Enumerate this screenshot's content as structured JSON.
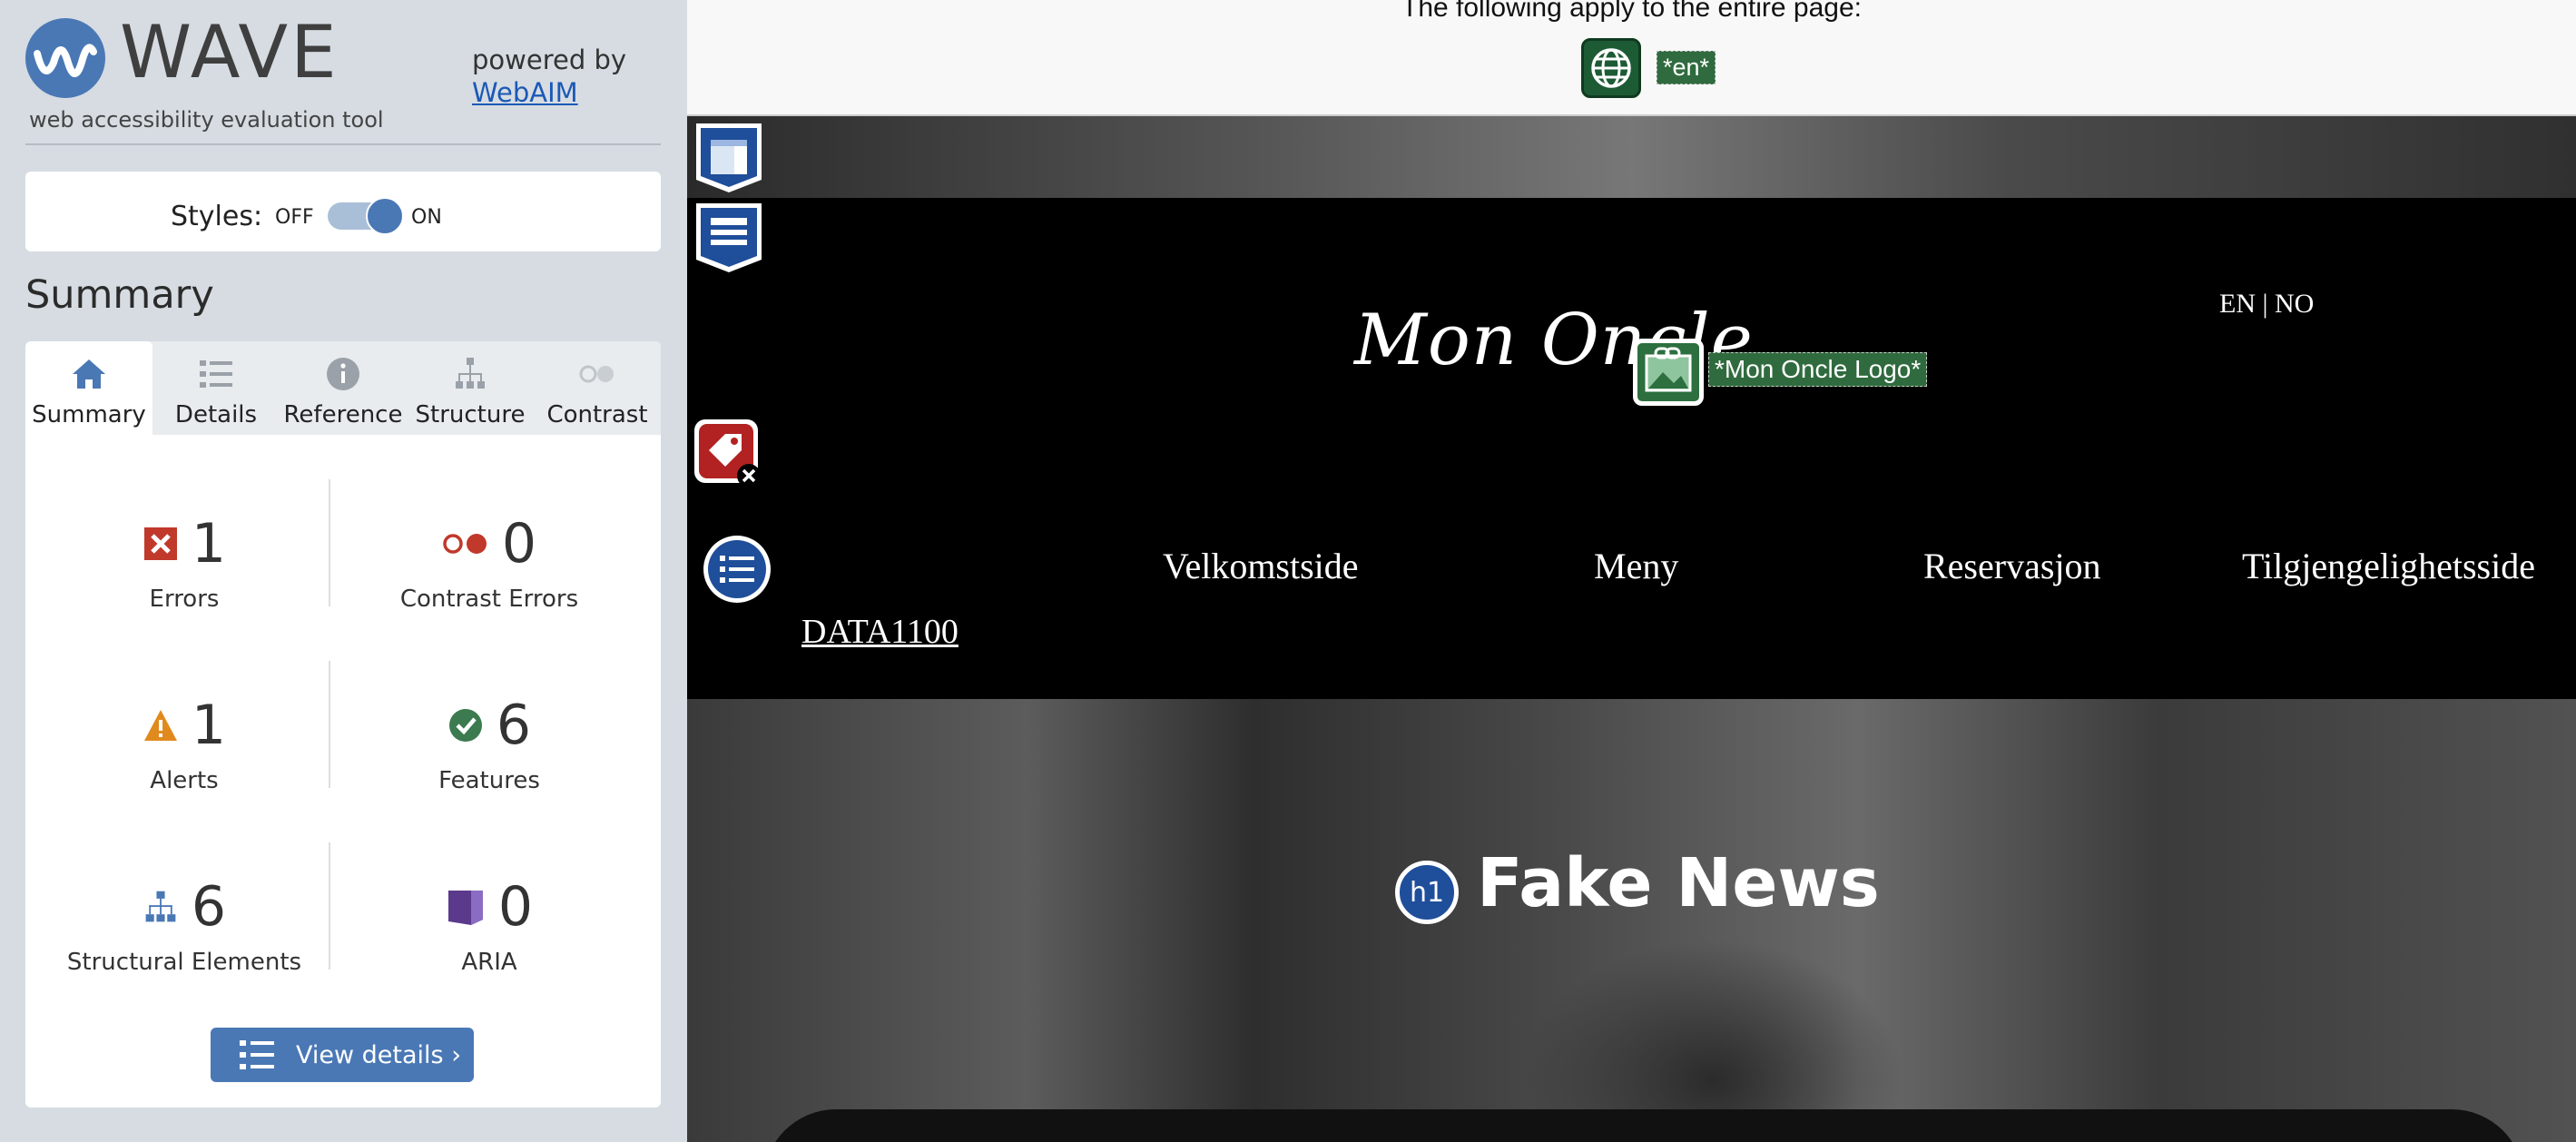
{
  "app": {
    "name": "WAVE",
    "tagline": "web accessibility evaluation tool",
    "powered_by": "powered by",
    "powered_by_link": "WebAIM"
  },
  "styles_toggle": {
    "label": "Styles:",
    "off_label": "OFF",
    "on_label": "ON",
    "state": "on"
  },
  "summary_heading": "Summary",
  "tabs": [
    {
      "label": "Summary",
      "icon": "home-icon",
      "active": true
    },
    {
      "label": "Details",
      "icon": "list-icon",
      "active": false
    },
    {
      "label": "Reference",
      "icon": "info-icon",
      "active": false
    },
    {
      "label": "Structure",
      "icon": "hierarchy-icon",
      "active": false
    },
    {
      "label": "Contrast",
      "icon": "contrast-icon",
      "active": false
    }
  ],
  "stats": {
    "errors": {
      "count": "1",
      "label": "Errors",
      "icon": "error-x-icon"
    },
    "contrast_errors": {
      "count": "0",
      "label": "Contrast Errors",
      "icon": "contrast-error-icon"
    },
    "alerts": {
      "count": "1",
      "label": "Alerts",
      "icon": "alert-triangle-icon"
    },
    "features": {
      "count": "6",
      "label": "Features",
      "icon": "checkmark-icon"
    },
    "structural": {
      "count": "6",
      "label": "Structural Elements",
      "icon": "structure-icon"
    },
    "aria": {
      "count": "0",
      "label": "ARIA",
      "icon": "aria-icon"
    }
  },
  "view_details_label": "View details ›",
  "colors": {
    "accent": "#4a78b5",
    "error": "#c0392b",
    "alert": "#e08a1e",
    "feature": "#3c7a4f",
    "aria": "#5b3a8c",
    "sidebar_bg": "#d6dce2"
  },
  "preview": {
    "page_notice": "The following apply to the entire page:",
    "lang_tag": "*en*",
    "brand": "Mon Oncle",
    "logo_alt_tag": "*Mon Oncle Logo*",
    "lang_switch": "EN | NO",
    "nav": [
      "Velkomstside",
      "Meny",
      "Reservasjon",
      "Tilgjengelighetsside",
      "DATA1100"
    ],
    "h1_badge": "h1",
    "hero_title": "Fake News"
  }
}
